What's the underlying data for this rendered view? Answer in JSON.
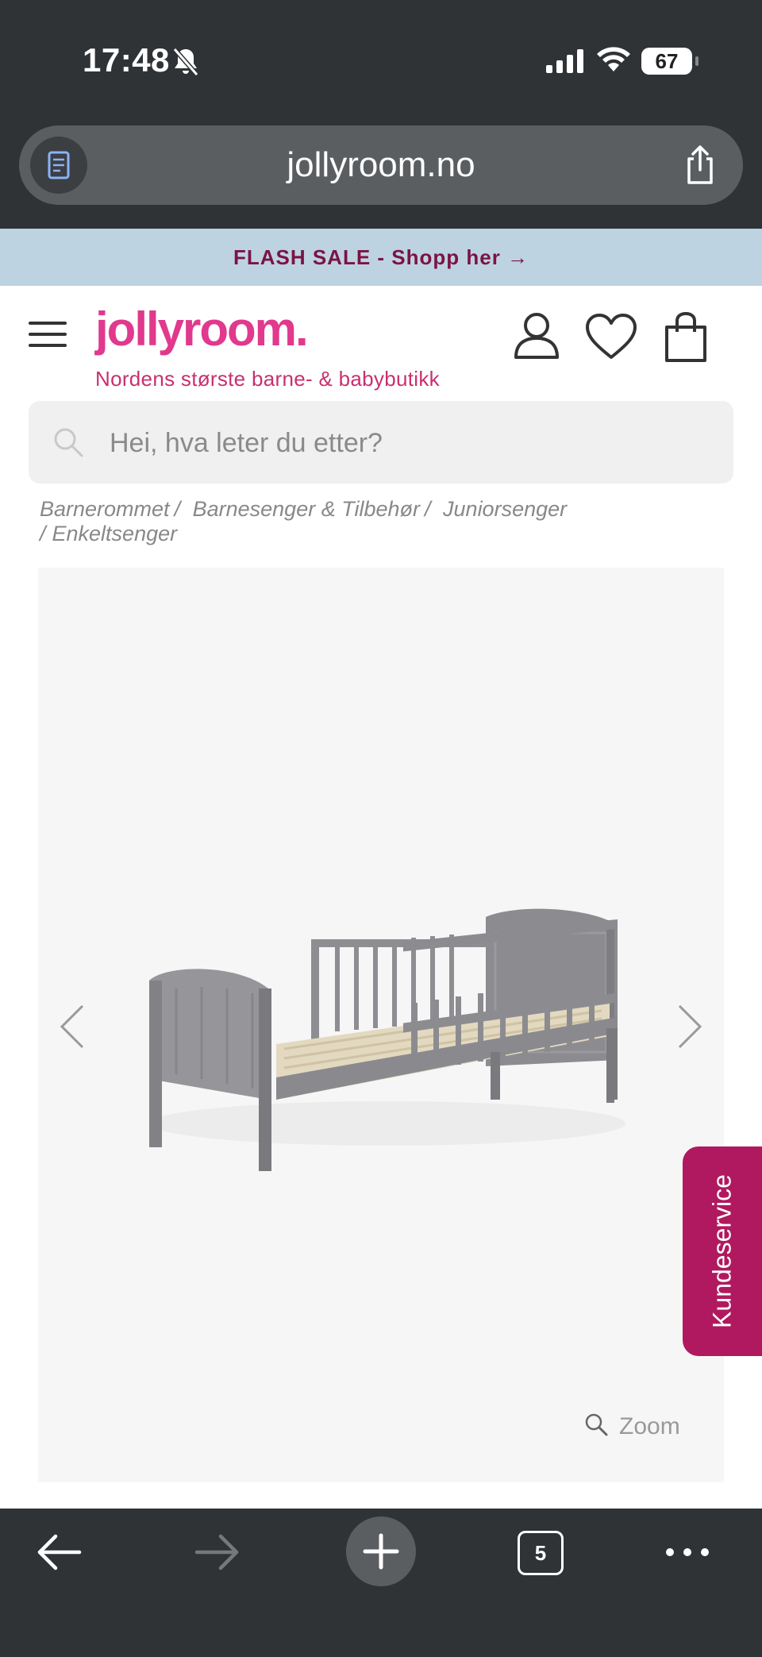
{
  "status_bar": {
    "time": "17:48",
    "battery": "67"
  },
  "browser": {
    "url": "jollyroom.no",
    "open_tabs": "5"
  },
  "flash_sale": "FLASH SALE - Shopp her →",
  "header": {
    "logo": "jollyroom.",
    "tagline": "Nordens største barne- & babybutikk"
  },
  "search": {
    "placeholder": "Hei, hva leter du etter?"
  },
  "breadcrumb": {
    "items": [
      "Barnerommet",
      "Barnesenger & Tilbehør",
      "Juniorsenger",
      "Enkeltsenger"
    ]
  },
  "product": {
    "zoom_label": "Zoom"
  },
  "customer_service": {
    "label": "Kundeservice"
  },
  "colors": {
    "brand_pink": "#e0398d",
    "flash_bg": "#bed3e2",
    "flash_text": "#7a1445",
    "service_tab": "#b0195f",
    "chrome_dark": "#2f3336"
  }
}
